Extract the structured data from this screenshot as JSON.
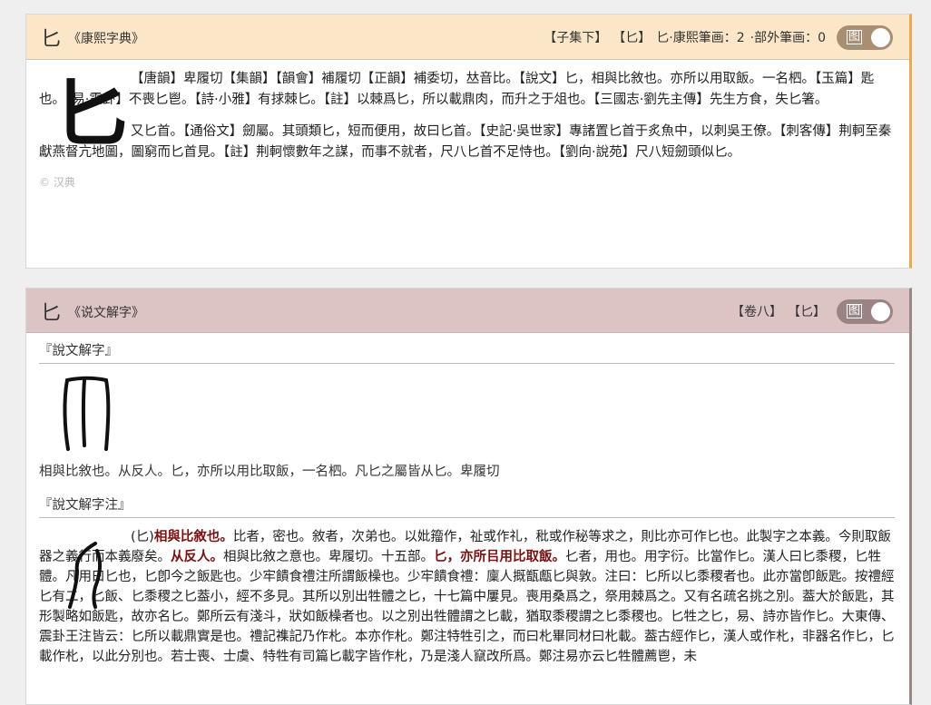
{
  "kangxi": {
    "char": "匕",
    "book": "《康熙字典》",
    "meta_volume": "【子集下】",
    "meta_radical": "【匕】",
    "meta_strokes": "匕·康熙筆画：2",
    "meta_extra": "·部外筆画：0",
    "toggle_label": "图",
    "big_char": "匕",
    "para1": "【唐韻】卑履切【集韻】【韻會】補履切【正韻】補委切，𠀤音比。【說文】匕，相與比敘也。亦所以用取飯。一名柶。【玉篇】匙也。【易·震卦】不喪匕鬯。【詩·小雅】有捄棘匕。【註】以棘爲匕，所以載鼎肉，而升之于俎也。【三國志·劉先主傳】先生方食，失匕箸。",
    "para2": "又匕首。【通俗文】劒屬。其頭類匕，短而便用，故曰匕首。【史記·吳世家】專諸置匕首于炙魚中，以刺吳王僚。【刺客傳】荆軻至秦獻燕督亢地圖，圖窮而匕首見。【註】荆軻懷數年之謀，而事不就者，尺八匕首不足恃也。【劉向·說苑】尺八短劒頭似匕。",
    "copyright": "© 汉典"
  },
  "shuowen": {
    "char": "匕",
    "book": "《说文解字》",
    "meta_volume": "【卷八】",
    "meta_radical": "【匕】",
    "toggle_label": "图",
    "section1_title": "『說文解字』",
    "section1_def": "相與比敘也。从反人。匕，亦所以用比取飯，一名柶。凡匕之屬皆从匕。卑履切",
    "section2_title": "『說文解字注』",
    "note_t1": "(匕)",
    "note_h1": "相與比敘也。",
    "note_t2": "比者，密也。敘者，次弟也。以妣籀作𠤝，祉或作礼，秕或作秘等求之，則比亦可作匕也。此製字之本義。今則取飯器之義行而本義廢矣。",
    "note_h2": "从反人。",
    "note_t3": "相與比敘之意也。卑履切。十五部。",
    "note_h3": "匕，亦所㠯用比取飯。",
    "note_t4": "𠤎者，用也。用字衍。比當作匕。漢人曰匕黍稷，匕牲體。凡用曰匕也，匕卽今之飯匙也。少牢饋食禮注所謂飯橾也。少牢饋食禮：廩人摡甑甗匕與敦。注曰：匕所以匕黍稷者也。此亦當卽飯匙。按禮經匕有二，匕飯、匕黍稷之匕葢小，經不多見。其所以別出牲體之匕，十七篇中屢見。喪用桑爲之，祭用棘爲之。又有名疏名挑之別。葢大於飯匙，其形製略如飯匙，故亦名匕。鄭所云有淺斗，狀如飯橾者也。以之別出牲體謂之匕載，猶取黍稷謂之匕黍稷也。匕牲之匕，易、詩亦皆作匕。大東傳、震卦王注皆云：匕所以載鼎實是也。禮記襍記乃作朼。本亦作朼。鄭注特牲引之，而曰朼畢同材曰朼載。葢古經作匕，漢人或作朼，非器名作匕，匕載作朼，以此分別也。若士喪、士虞、特牲有司篇匕載字皆作朼，乃是淺人竄改所爲。鄭注易亦云匕牲體薦鬯，未"
  }
}
